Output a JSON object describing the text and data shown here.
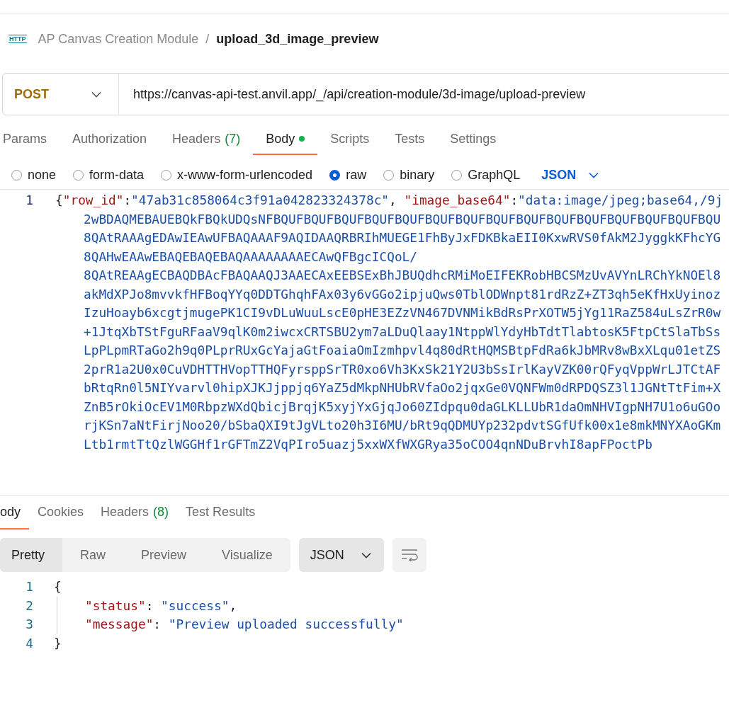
{
  "header": {
    "icon_text": "HTTP",
    "collection": "AP Canvas Creation Module",
    "separator": "/",
    "request_name": "upload_3d_image_preview"
  },
  "request": {
    "method": "POST",
    "url": "https://canvas-api-test.anvil.app/_/api/creation-module/3d-image/upload-preview"
  },
  "request_tabs": [
    {
      "label": "Params",
      "selected": false
    },
    {
      "label": "Authorization",
      "selected": false
    },
    {
      "label": "Headers",
      "count": "(7)",
      "selected": false
    },
    {
      "label": "Body",
      "has_content": true,
      "selected": true
    },
    {
      "label": "Scripts",
      "selected": false
    },
    {
      "label": "Tests",
      "selected": false
    },
    {
      "label": "Settings",
      "selected": false
    }
  ],
  "body_types": [
    {
      "label": "none",
      "selected": false
    },
    {
      "label": "form-data",
      "selected": false
    },
    {
      "label": "x-www-form-urlencoded",
      "selected": false
    },
    {
      "label": "raw",
      "selected": true
    },
    {
      "label": "binary",
      "selected": false
    },
    {
      "label": "GraphQL",
      "selected": false
    }
  ],
  "body_format": "JSON",
  "request_body": {
    "line_number": "1",
    "first_line": [
      {
        "kind": "punct",
        "text": "{"
      },
      {
        "kind": "key",
        "text": "\"row_id\""
      },
      {
        "kind": "punct",
        "text": ":"
      },
      {
        "kind": "string",
        "text": "\"47ab31c858064c3f91a042823324378c\""
      },
      {
        "kind": "punct",
        "text": ", "
      },
      {
        "kind": "key",
        "text": "\"image_base64\""
      },
      {
        "kind": "punct",
        "text": ":"
      },
      {
        "kind": "string",
        "text": "\"data:image/jpeg;base64,/9j"
      }
    ],
    "wrapped_lines": [
      "2wBDAQMEBAUEBQkFBQkUDQsNFBQUFBQUFBQUFBQUFBQUFBQUFBQUFBQUFBQUFBQUFBQUFBQUFBQUFBQUFBQU",
      "8QAtRAAAgEDAwIEAwUFBAQAAAF9AQIDAAQRBRIhMUEGE1FhByJxFDKBkaEII0KxwRVS0fAkM2JyggkKFhcYG",
      "8QAHwEAAwEBAQEBAQEBAQAAAAAAAAECAwQFBgcICQoL/",
      "8QAtREAAgECBAQDBAcFBAQAAQJ3AAECAxEEBSExBhJBUQdhcRMiMoEIFEKRobHBCSMzUvAVYnLRChYkNOEl8",
      "akMdXPJo8mvvkfHFBoqYYq0DDTGhqhFAx03y6vGGo2ipjuQws0TblODWnpt81rdRzZ+ZT3qh5eKfHxUyinoz",
      "IzuHoayb6xcgtjmugePK1CI9vDLuWuuLscE0pHE3EZzVN467DVNMikBdRsPrXOTW5jYg11RaZ584uLsZrR0w",
      "+1JtqXbTStFguRFaaV9qlK0m2iwcxCRTSBU2ym7aLDuQlaay1NtppWlYdyHbTdtTlabtosK5FtpCtSlaTbSs",
      "LpPLpmRTaGo2h9q0PLprRUxGcYajaGtFoaiaOmIzmhpvl4q80dRtHQMSBtpFdRa6kJbMRv8wBxXLqu01etZS",
      "2prR1a2U0x0CuVDHTTHVopTTHQFyrsppSrTR0xo6Vh3KxSk21Y2U3bSsIrlKayVZK00rQFyqVppWrLJTCtAF",
      "bRtqRn0l5NIYvarvl0hipXJKJjppjq6YaZ5dMkpNHUbRVfaOo2jqxGe0VQNFWm0dRPDQSZ3l1JGNtTtFim+X",
      "ZnB5rOkiOcEV1M0RbpzWXdQbicjBrqjK5xyjYxGjqJo60ZIdpqu0daGLKLLUbR1daOmNHVIgpNH7U1o6uGOo",
      "rjKSn7aNtFirjNoo20/bSbaQXI9tJgVLto20h3I6MU/bRt9qQDMUYp232pdvtSGfUfk00x1e8mkMNYXAoGKm",
      "Ltb1rmtTtQzlWGGHf1rGFTmZ2VqPIro5uazj5xxWXfWXGRya35oCOO4qnNDuBrvhI8apFPoctPb"
    ]
  },
  "response_tabs": [
    {
      "label": "ody",
      "selected": true
    },
    {
      "label": "Cookies",
      "selected": false
    },
    {
      "label": "Headers",
      "count": "(8)",
      "selected": false
    },
    {
      "label": "Test Results",
      "selected": false
    }
  ],
  "view_modes": [
    {
      "label": "Pretty",
      "selected": true
    },
    {
      "label": "Raw",
      "selected": false
    },
    {
      "label": "Preview",
      "selected": false
    },
    {
      "label": "Visualize",
      "selected": false
    }
  ],
  "response_format": "JSON",
  "response_body": [
    {
      "number": "1",
      "indent": false,
      "tokens": [
        {
          "kind": "punct",
          "text": "{"
        }
      ]
    },
    {
      "number": "2",
      "indent": true,
      "tokens": [
        {
          "kind": "key",
          "text": "\"status\""
        },
        {
          "kind": "punct",
          "text": ": "
        },
        {
          "kind": "string",
          "text": "\"success\""
        },
        {
          "kind": "punct",
          "text": ","
        }
      ]
    },
    {
      "number": "3",
      "indent": true,
      "tokens": [
        {
          "kind": "key",
          "text": "\"message\""
        },
        {
          "kind": "punct",
          "text": ": "
        },
        {
          "kind": "string",
          "text": "\"Preview uploaded successfully\""
        }
      ]
    },
    {
      "number": "4",
      "indent": false,
      "tokens": [
        {
          "kind": "punct",
          "text": "}"
        }
      ]
    }
  ]
}
